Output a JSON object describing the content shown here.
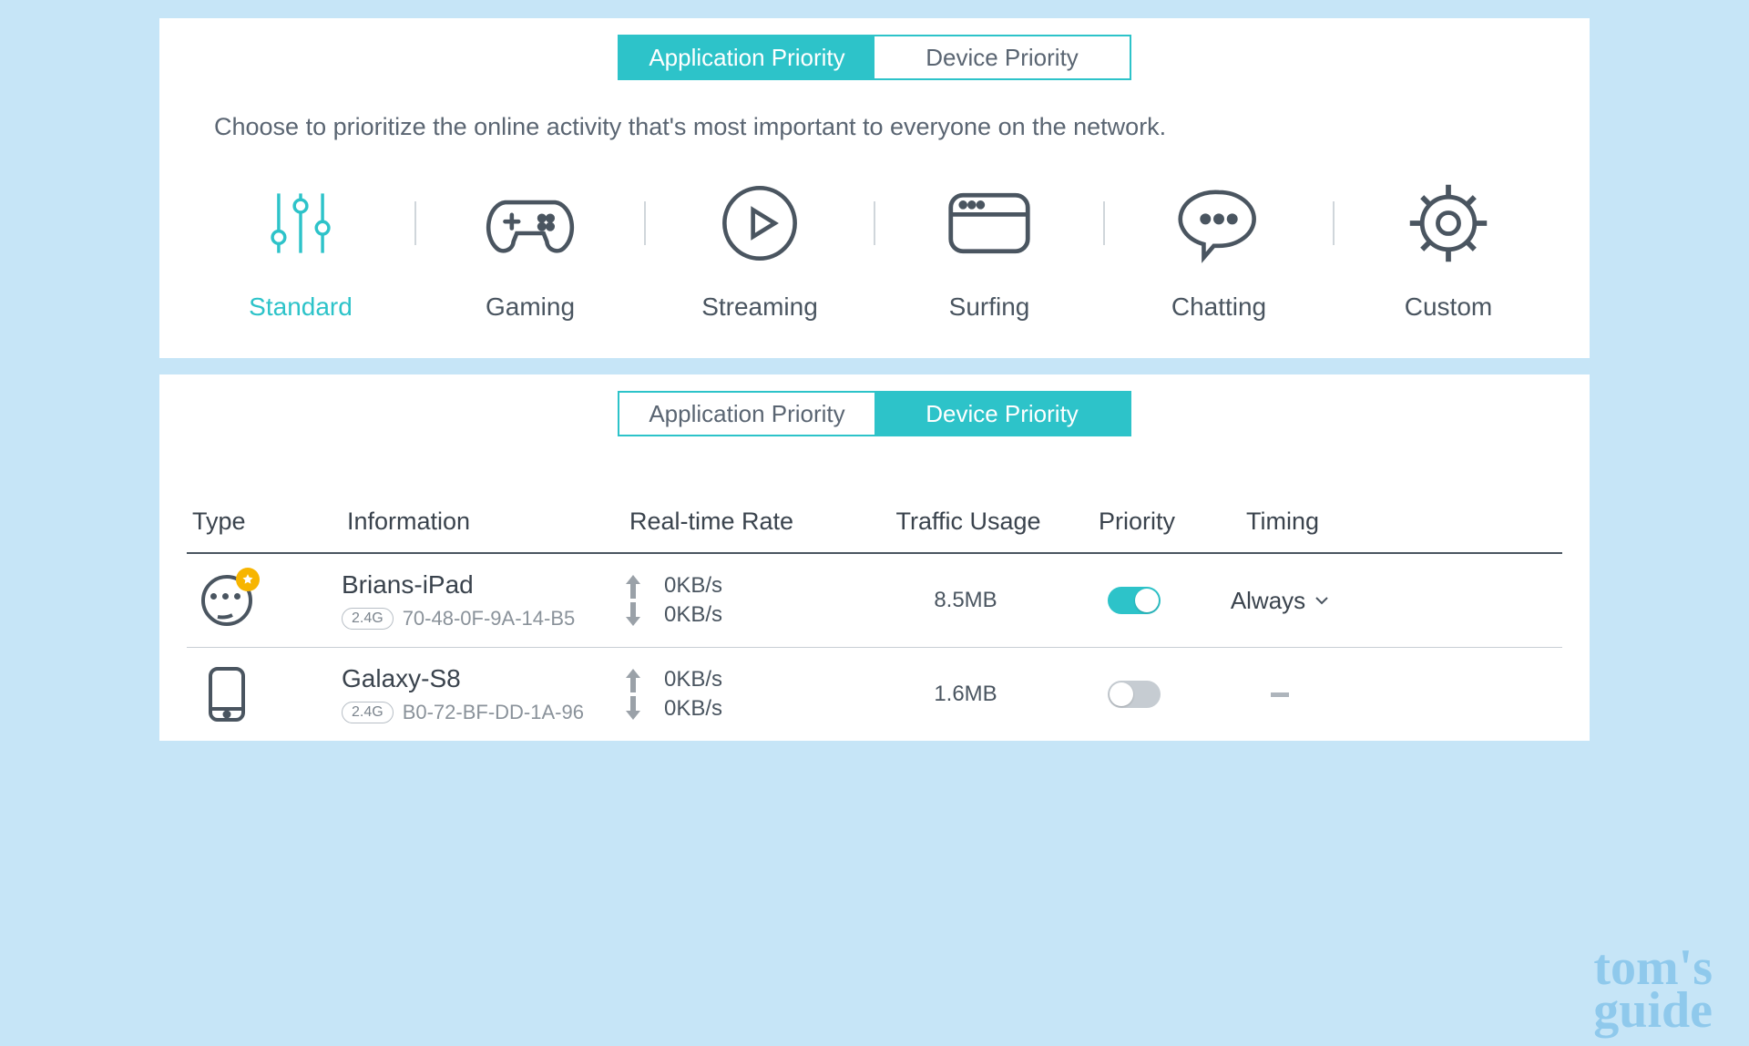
{
  "panel1": {
    "tabs": {
      "app": "Application Priority",
      "dev": "Device Priority"
    },
    "desc": "Choose to prioritize the online activity that's most important to everyone on the network.",
    "modes": {
      "standard": "Standard",
      "gaming": "Gaming",
      "streaming": "Streaming",
      "surfing": "Surfing",
      "chatting": "Chatting",
      "custom": "Custom"
    }
  },
  "panel2": {
    "tabs": {
      "app": "Application Priority",
      "dev": "Device Priority"
    },
    "headers": {
      "type": "Type",
      "info": "Information",
      "rate": "Real-time Rate",
      "usage": "Traffic Usage",
      "priority": "Priority",
      "timing": "Timing"
    },
    "rows": [
      {
        "name": "Brians-iPad",
        "band": "2.4G",
        "mac": "70-48-0F-9A-14-B5",
        "up": "0KB/s",
        "down": "0KB/s",
        "usage": "8.5MB",
        "priority_on": true,
        "timing": "Always"
      },
      {
        "name": "Galaxy-S8",
        "band": "2.4G",
        "mac": "B0-72-BF-DD-1A-96",
        "up": "0KB/s",
        "down": "0KB/s",
        "usage": "1.6MB",
        "priority_on": false,
        "timing": "-"
      }
    ]
  },
  "watermark": {
    "l1": "tom's",
    "l2": "guide"
  }
}
